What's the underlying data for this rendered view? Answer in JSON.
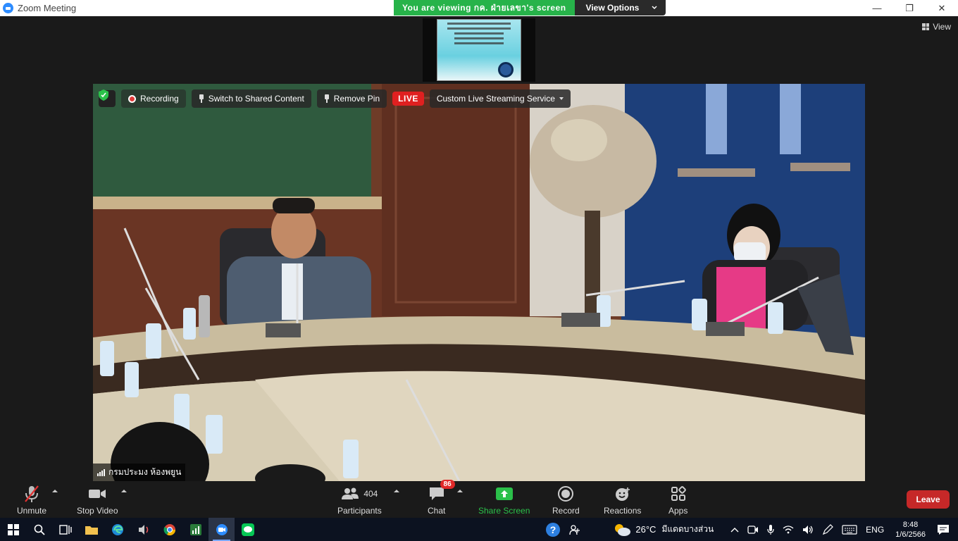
{
  "window": {
    "title": "Zoom Meeting",
    "controls": {
      "minimize": "—",
      "restore": "❐",
      "close": "✕"
    }
  },
  "banner": {
    "viewing_text": "You are viewing กค. ฝ่ายเลขา's screen",
    "view_options_label": "View Options"
  },
  "top_right": {
    "view_label": "View"
  },
  "video_toolbar": {
    "recording_label": "Recording",
    "switch_label": "Switch to Shared Content",
    "remove_pin_label": "Remove Pin",
    "live_label": "LIVE",
    "streaming_label": "Custom Live Streaming Service"
  },
  "participant": {
    "name": "กรมประมง ห้องพยูน"
  },
  "toolbar": {
    "unmute": "Unmute",
    "stop_video": "Stop Video",
    "participants": "Participants",
    "participants_count": "404",
    "chat": "Chat",
    "chat_badge": "86",
    "share_screen": "Share Screen",
    "record": "Record",
    "reactions": "Reactions",
    "apps": "Apps",
    "leave": "Leave"
  },
  "taskbar": {
    "temperature": "26°C",
    "weather_text": "มีแดดบางส่วน",
    "language": "ENG",
    "time": "8:48",
    "date": "1/6/2566"
  },
  "colors": {
    "accent_green": "#27b34a",
    "live_red": "#e02020",
    "leave_red": "#c62828",
    "share_green": "#2bc04a",
    "zoom_blue": "#2d8cff"
  }
}
